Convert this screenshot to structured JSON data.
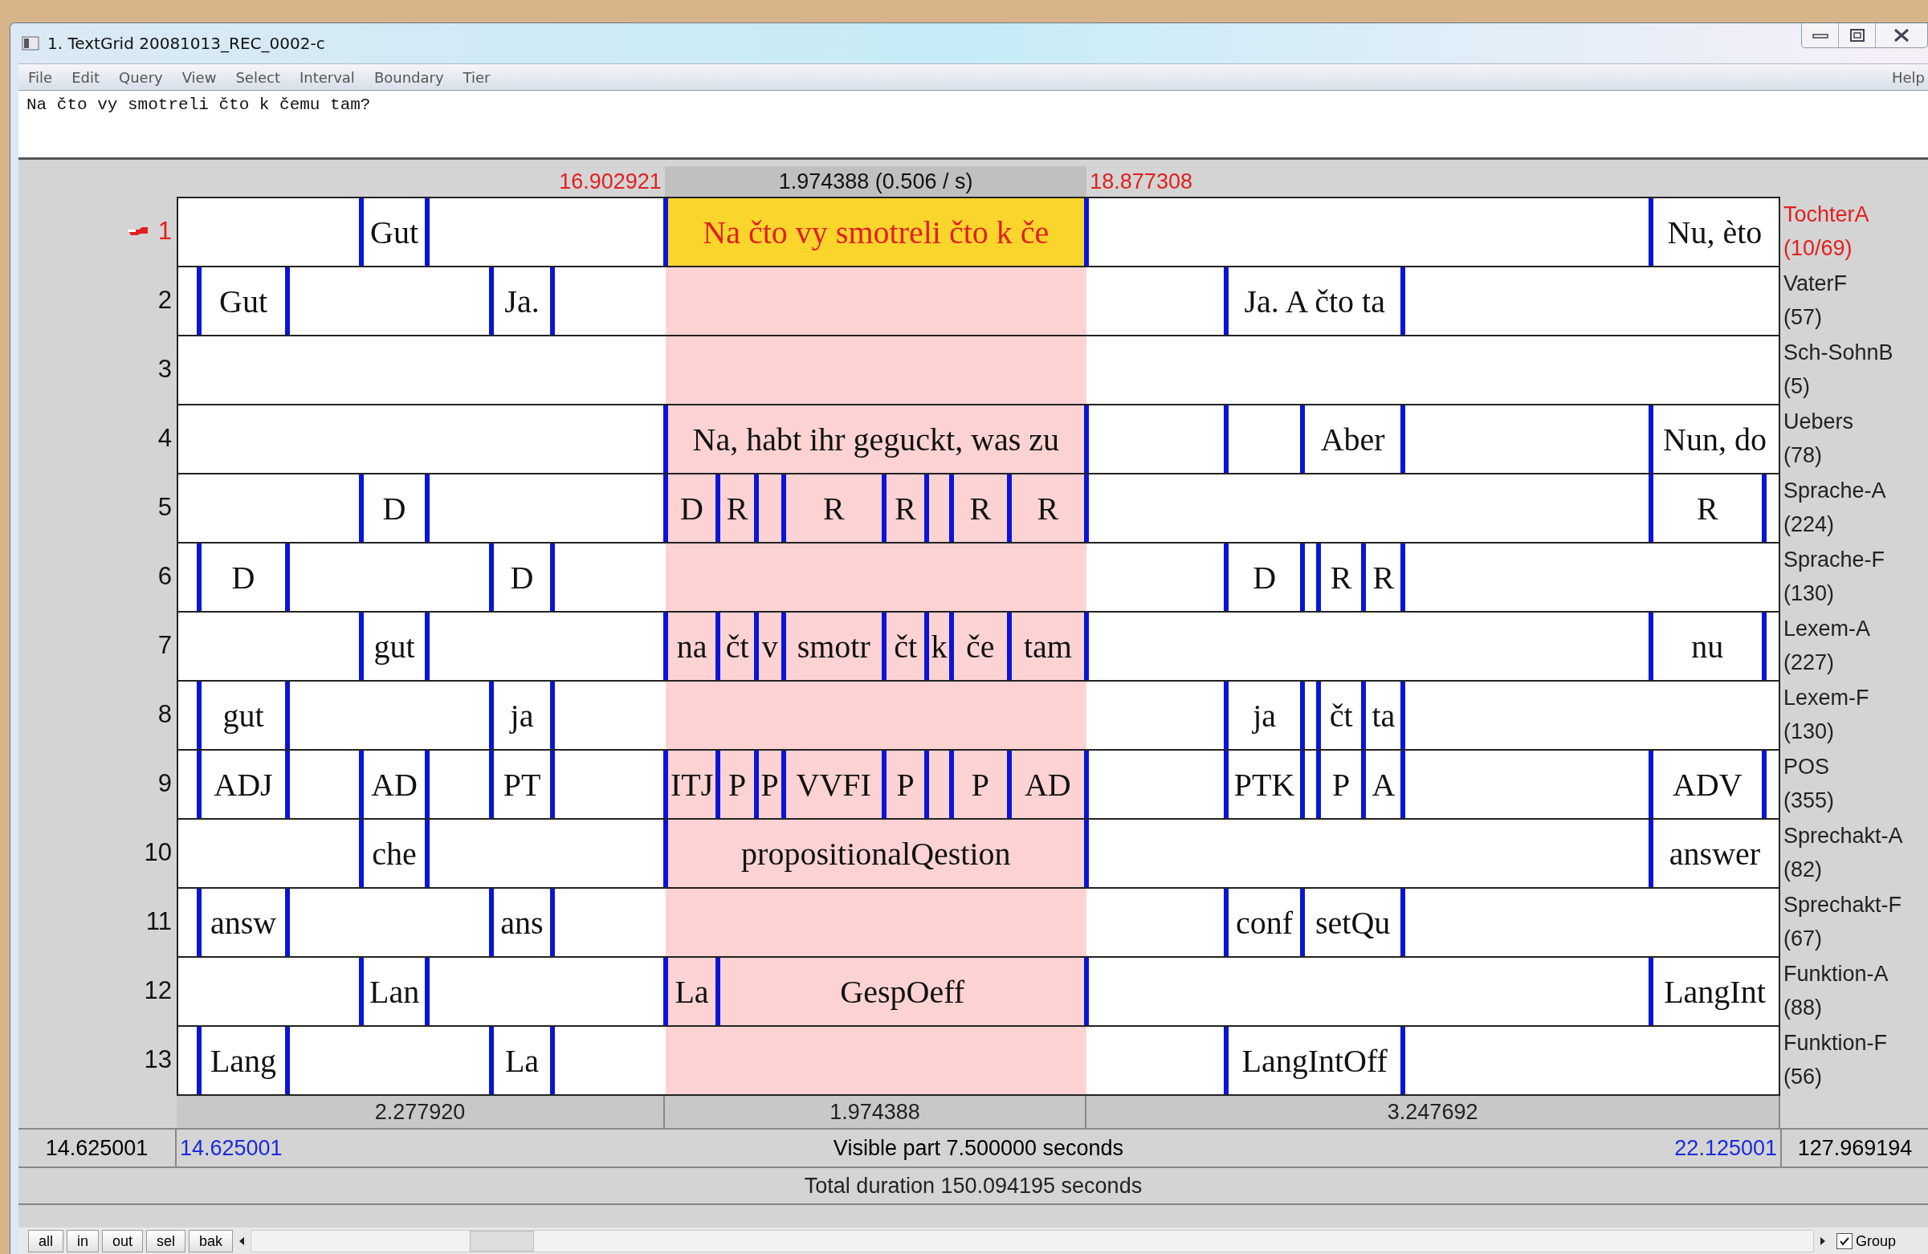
{
  "window": {
    "title": "1. TextGrid 20081013_REC_0002-c"
  },
  "menu": [
    "File",
    "Edit",
    "Query",
    "View",
    "Select",
    "Interval",
    "Boundary",
    "Tier"
  ],
  "help_menu": "Help",
  "text_field": {
    "value": "Na čto vy smotreli čto k čemu tam?"
  },
  "selection": {
    "start": "16.902921",
    "duration": "1.974388 (0.506 / s)",
    "end": "18.877308"
  },
  "tiers": [
    {
      "number": "1",
      "name": "TochterA",
      "count": "(10/69)",
      "selected": true,
      "intervals": [
        {
          "text": "Gut",
          "selected": false
        },
        {
          "text": "Na čto vy smotreli čto k če",
          "selected": true
        },
        {
          "text": "Nu, èto",
          "selected": false
        }
      ]
    },
    {
      "number": "2",
      "name": "VaterF",
      "count": "(57)",
      "selected": false,
      "intervals": [
        {
          "text": "Gut",
          "selected": false
        },
        {
          "text": "Ja.",
          "selected": false
        },
        {
          "text": "Ja. A čto ta",
          "selected": false
        }
      ]
    },
    {
      "number": "3",
      "name": "Sch-SohnB",
      "count": "(5)",
      "selected": false
    },
    {
      "number": "4",
      "name": "Uebers",
      "count": "(78)",
      "selected": false,
      "intervals": [
        {
          "text": "Na, habt ihr geguckt, was zu",
          "selected": false
        },
        {
          "text": "Aber",
          "selected": false
        },
        {
          "text": "Nun, do",
          "selected": false
        }
      ]
    },
    {
      "number": "5",
      "name": "Sprache-A",
      "count": "(224)",
      "selected": false,
      "intervals": [
        {
          "text": "D",
          "selected": false
        },
        {
          "text": "D",
          "selected": false
        },
        {
          "text": "R",
          "selected": false
        },
        {
          "text": "R",
          "selected": false
        },
        {
          "text": "R",
          "selected": false
        },
        {
          "text": "R",
          "selected": false
        },
        {
          "text": "R",
          "selected": false
        },
        {
          "text": "R",
          "selected": false
        }
      ]
    },
    {
      "number": "6",
      "name": "Sprache-F",
      "count": "(130)",
      "selected": false,
      "intervals": [
        {
          "text": "D",
          "selected": false
        },
        {
          "text": "D",
          "selected": false
        },
        {
          "text": "D",
          "selected": false
        },
        {
          "text": "R",
          "selected": false
        },
        {
          "text": "R",
          "selected": false
        }
      ]
    },
    {
      "number": "7",
      "name": "Lexem-A",
      "count": "(227)",
      "selected": false,
      "intervals": [
        {
          "text": "gut",
          "selected": false
        },
        {
          "text": "na",
          "selected": false
        },
        {
          "text": "čt",
          "selected": false
        },
        {
          "text": "v",
          "selected": false
        },
        {
          "text": "smotr",
          "selected": false
        },
        {
          "text": "čt",
          "selected": false
        },
        {
          "text": "k",
          "selected": false
        },
        {
          "text": "če",
          "selected": false
        },
        {
          "text": "tam",
          "selected": false
        },
        {
          "text": "nu",
          "selected": false
        }
      ]
    },
    {
      "number": "8",
      "name": "Lexem-F",
      "count": "(130)",
      "selected": false,
      "intervals": [
        {
          "text": "gut",
          "selected": false
        },
        {
          "text": "ja",
          "selected": false
        },
        {
          "text": "ja",
          "selected": false
        },
        {
          "text": "čt",
          "selected": false
        },
        {
          "text": "ta",
          "selected": false
        }
      ]
    },
    {
      "number": "9",
      "name": "POS",
      "count": "(355)",
      "selected": false,
      "intervals": [
        {
          "text": "ADJ",
          "selected": false
        },
        {
          "text": "AD",
          "selected": false
        },
        {
          "text": "PT",
          "selected": false
        },
        {
          "text": "ITJ",
          "selected": false
        },
        {
          "text": "P",
          "selected": false
        },
        {
          "text": "P",
          "selected": false
        },
        {
          "text": "VVFI",
          "selected": false
        },
        {
          "text": "P",
          "selected": false
        },
        {
          "text": "P",
          "selected": false
        },
        {
          "text": "AD",
          "selected": false
        },
        {
          "text": "PTK",
          "selected": false
        },
        {
          "text": "P",
          "selected": false
        },
        {
          "text": "A",
          "selected": false
        },
        {
          "text": "ADV",
          "selected": false
        }
      ]
    },
    {
      "number": "10",
      "name": "Sprechakt-A",
      "count": "(82)",
      "selected": false,
      "intervals": [
        {
          "text": "che",
          "selected": false
        },
        {
          "text": "propositionalQestion",
          "selected": false
        },
        {
          "text": "answer",
          "selected": false
        }
      ]
    },
    {
      "number": "11",
      "name": "Sprechakt-F",
      "count": "(67)",
      "selected": false,
      "intervals": [
        {
          "text": "answ",
          "selected": false
        },
        {
          "text": "ans",
          "selected": false
        },
        {
          "text": "conf",
          "selected": false
        },
        {
          "text": "setQu",
          "selected": false
        }
      ]
    },
    {
      "number": "12",
      "name": "Funktion-A",
      "count": "(88)",
      "selected": false,
      "intervals": [
        {
          "text": "Lan",
          "selected": false
        },
        {
          "text": "La",
          "selected": false
        },
        {
          "text": "GespOeff",
          "selected": false
        },
        {
          "text": "LangInt",
          "selected": false
        }
      ]
    },
    {
      "number": "13",
      "name": "Funktion-F",
      "count": "(56)",
      "selected": false,
      "intervals": [
        {
          "text": "Lang",
          "selected": false
        },
        {
          "text": "La",
          "selected": false
        },
        {
          "text": "LangIntOff",
          "selected": false
        }
      ]
    }
  ],
  "durations": [
    "2.277920",
    "1.974388",
    "3.247692"
  ],
  "visible": {
    "total_start": "14.625001",
    "start": "14.625001",
    "label": "Visible part 7.500000 seconds",
    "end": "22.125001",
    "total_end": "127.969194"
  },
  "total": "Total duration 150.094195 seconds",
  "buttons": [
    "all",
    "in",
    "out",
    "sel",
    "bak"
  ],
  "group_checkbox": {
    "label": "Group",
    "checked": true
  }
}
